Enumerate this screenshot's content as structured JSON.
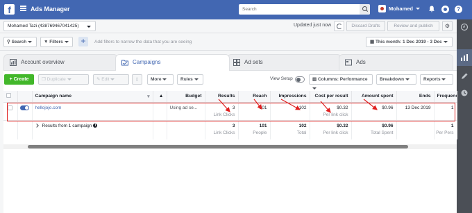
{
  "app": {
    "title": "Ads Manager",
    "search_placeholder": "Search",
    "user_name": "Mohamed",
    "brand_color": "#4267b2"
  },
  "account": {
    "label": "Mohamed Tazi (438769467041425)"
  },
  "status": {
    "saved_text": "Updated just now",
    "discard_label": "Discard Drafts",
    "review_label": "Review and publish"
  },
  "filters": {
    "search_label": "Search",
    "filters_label": "Filters",
    "placeholder": "Add filters to narrow the data that you are seeing",
    "date_range": "This month: 1 Dec 2019 - 3 Dec"
  },
  "tabs": [
    {
      "label": "Account overview",
      "icon": "overview-icon"
    },
    {
      "label": "Campaigns",
      "icon": "folder-icon"
    },
    {
      "label": "Ad sets",
      "icon": "grid-icon"
    },
    {
      "label": "Ads",
      "icon": "ad-icon"
    }
  ],
  "toolbar": {
    "create": "Create",
    "duplicate": "Duplicate",
    "edit": "Edit",
    "more": "More",
    "rules": "Rules",
    "view_setup": "View Setup",
    "columns": "Columns: Performance",
    "breakdown": "Breakdown",
    "reports": "Reports"
  },
  "table": {
    "headers": [
      "Campaign name",
      "Budget",
      "Results",
      "Reach",
      "Impressions",
      "Cost per result",
      "Amount spent",
      "Ends",
      "Frequency"
    ],
    "row": {
      "name": "hellojojo.com",
      "budget": "Using ad se...",
      "results": "3",
      "results_sub": "Link Clicks",
      "reach": "101",
      "impressions": "102",
      "cost": "$0.32",
      "cost_sub": "Per link click",
      "spent": "$0.96",
      "ends": "13 Dec 2019",
      "frequency": "1"
    },
    "total": {
      "label": "Results from 1 campaign",
      "results": "3",
      "results_sub": "Link Clicks",
      "reach": "101",
      "reach_sub": "People",
      "impressions": "102",
      "impressions_sub": "Total",
      "cost": "$0.32",
      "cost_sub": "Per link click",
      "spent": "$0.96",
      "spent_sub": "Total Spent",
      "frequency": "1",
      "frequency_sub": "Per Pers"
    }
  },
  "colors": {
    "highlight": "#e02020",
    "create": "#42b72a"
  }
}
